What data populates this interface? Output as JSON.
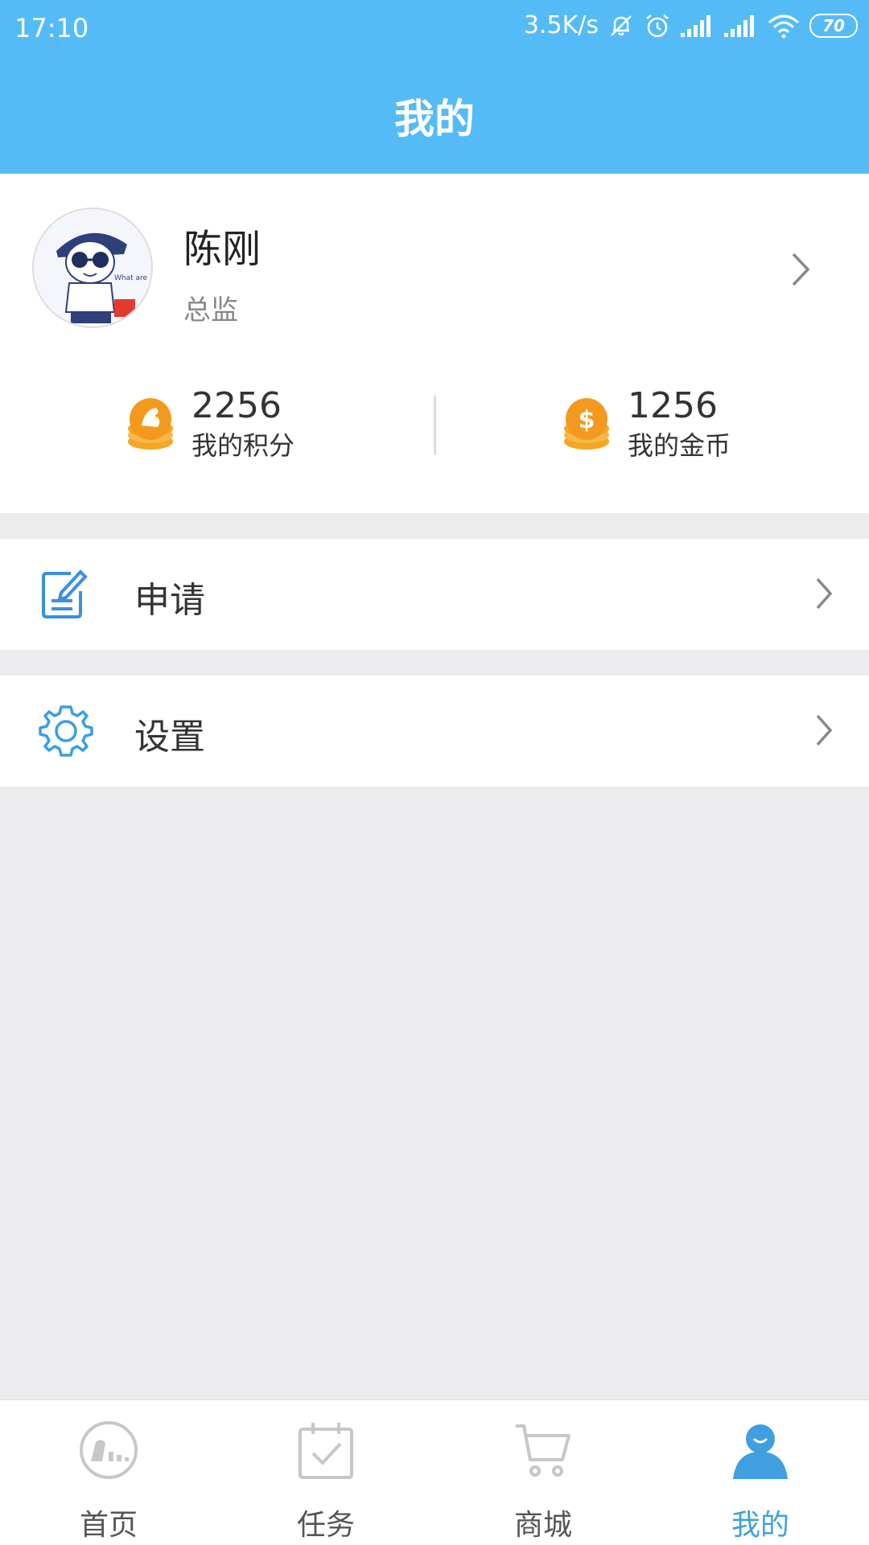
{
  "status_bar": {
    "time": "17:10",
    "network_speed": "3.5K/s",
    "battery": "70"
  },
  "header": {
    "title": "我的"
  },
  "profile": {
    "name": "陈刚",
    "role": "总监"
  },
  "stats": [
    {
      "value": "2256",
      "label": "我的积分"
    },
    {
      "value": "1256",
      "label": "我的金币"
    }
  ],
  "menu": [
    {
      "label": "申请",
      "icon": "edit-document-icon"
    },
    {
      "label": "设置",
      "icon": "gear-icon"
    }
  ],
  "tabs": [
    {
      "label": "首页",
      "icon": "home-icon",
      "active": false
    },
    {
      "label": "任务",
      "icon": "task-calendar-icon",
      "active": false
    },
    {
      "label": "商城",
      "icon": "cart-icon",
      "active": false
    },
    {
      "label": "我的",
      "icon": "user-icon",
      "active": true
    }
  ],
  "colors": {
    "primary": "#54bbf7",
    "active_tab": "#3f9fe0",
    "coin": "#f39a1e",
    "background": "#ececee"
  }
}
